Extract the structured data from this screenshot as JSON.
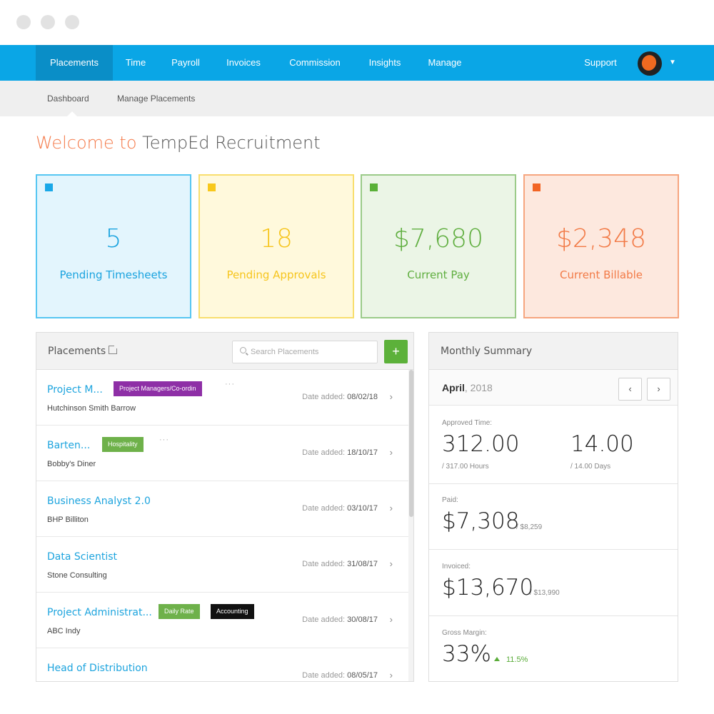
{
  "nav": {
    "items": [
      "Placements",
      "Time",
      "Payroll",
      "Invoices",
      "Commission",
      "Insights",
      "Manage"
    ],
    "support": "Support"
  },
  "subnav": {
    "items": [
      "Dashboard",
      "Manage Placements"
    ]
  },
  "welcome": {
    "prefix": "Welcome to",
    "company": "TempEd Recruitment"
  },
  "stats": [
    {
      "value": "5",
      "label": "Pending Timesheets",
      "color": "#1aa3df"
    },
    {
      "value": "18",
      "label": "Pending Approvals",
      "color": "#f6c51d"
    },
    {
      "value": "$7,680",
      "label": "Current Pay",
      "color": "#5fae3f"
    },
    {
      "value": "$2,348",
      "label": "Current Billable",
      "color": "#f27a46"
    }
  ],
  "placements": {
    "title": "Placements",
    "search_placeholder": "Search Placements",
    "add_label": "+",
    "rows": [
      {
        "title": "Project M...",
        "company": "Hutchinson Smith Barrow",
        "date_label": "Date added:",
        "date": "08/02/18",
        "tags": [
          "Project Managers/Co-ordin"
        ],
        "more": "···"
      },
      {
        "title": "Barten...",
        "company": "Bobby's Diner",
        "date_label": "Date added:",
        "date": "18/10/17",
        "tags": [
          "Hospitality"
        ],
        "more": "···"
      },
      {
        "title": "Business Analyst 2.0",
        "company": "BHP Billiton",
        "date_label": "Date added:",
        "date": "03/10/17",
        "tags": []
      },
      {
        "title": "Data Scientist",
        "company": "Stone Consulting",
        "date_label": "Date added:",
        "date": "31/08/17",
        "tags": []
      },
      {
        "title": "Project Administrat...",
        "company": "ABC Indy",
        "date_label": "Date added:",
        "date": "30/08/17",
        "tags": [
          "Daily Rate",
          "Accounting"
        ]
      },
      {
        "title": "Head of Distribution",
        "company": "",
        "date_label": "Date added:",
        "date": "08/05/17",
        "tags": []
      }
    ]
  },
  "summary": {
    "title": "Monthly Summary",
    "month": "April",
    "year": ", 2018",
    "prev": "‹",
    "next": "›",
    "approved_label": "Approved Time:",
    "hours_value": "312.00",
    "hours_sub": "/ 317.00 Hours",
    "days_value": "14.00",
    "days_sub": "/ 14.00 Days",
    "paid_label": "Paid:",
    "paid_value": "$7,308",
    "paid_sub": "/ $8,259",
    "invoiced_label": "Invoiced:",
    "invoiced_value": "$13,670",
    "invoiced_sub": "/ $13,990",
    "margin_label": "Gross Margin:",
    "margin_value": "33%",
    "margin_trend": "11.5%"
  }
}
